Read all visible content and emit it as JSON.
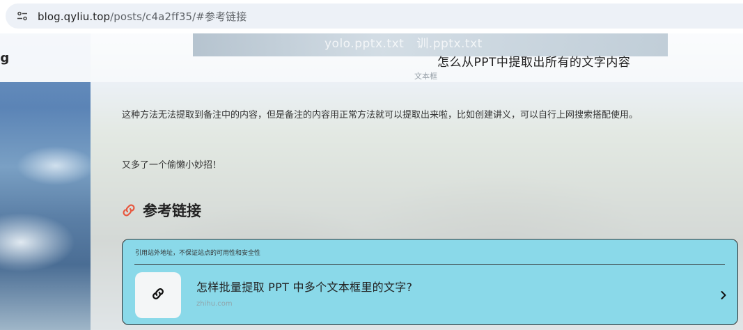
{
  "browser": {
    "site_info_icon": "tune-icon",
    "url_host": "blog.qyliu.top",
    "url_path": "/posts/c4a2ff35/#参考链接"
  },
  "sidebar": {
    "brand": "og"
  },
  "header_image": {
    "ghost_files": [
      "yolo.pptx.txt",
      "训.pptx.txt"
    ],
    "caption_title": "怎么从PPT中提取出所有的文字内容",
    "caption_sub": "文本框"
  },
  "article": {
    "para1": "这种方法无法提取到备注中的内容，但是备注的内容用正常方法就可以提取出来啦，比如创建讲义，可以自行上网搜索搭配使用。",
    "para2": "又多了一个偷懒小妙招！",
    "ref_heading": "参考链接",
    "ref_heading_icon": "link-icon"
  },
  "link_card": {
    "notice": "引用站外地址，不保证站点的可用性和安全性",
    "title": "怎样批量提取 PPT 中多个文本框里的文字?",
    "domain": "zhihu.com",
    "icon": "link-icon",
    "arrow": "chevron-right-icon"
  },
  "colors": {
    "card_bg": "#8ad9e9",
    "heading_icon": "#e8553c"
  }
}
